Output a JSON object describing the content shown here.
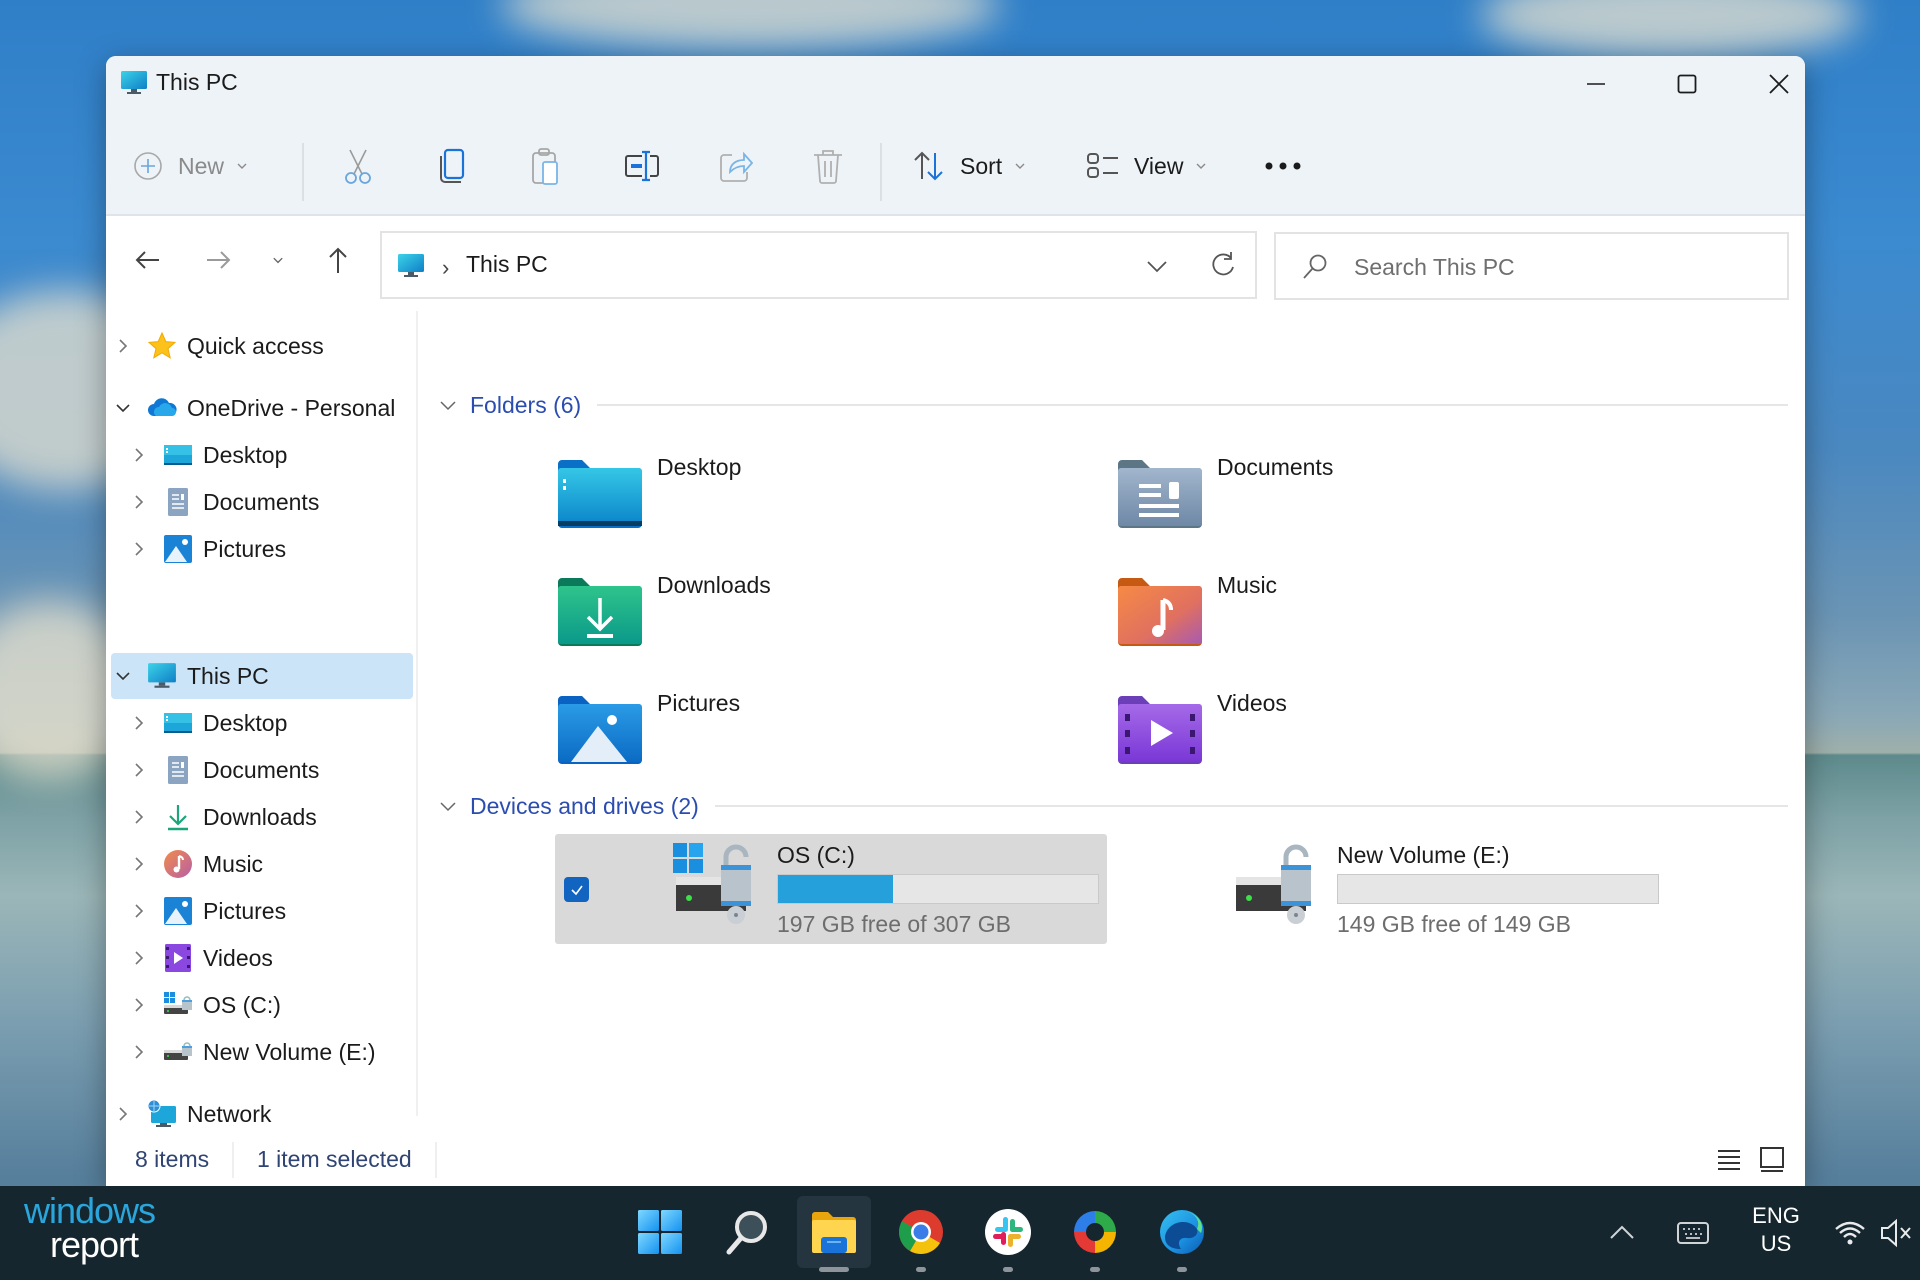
{
  "window": {
    "title": "This PC",
    "controls": {
      "minimize": "minimize",
      "maximize": "maximize",
      "close": "close"
    }
  },
  "toolbar": {
    "new_label": "New",
    "sort_label": "Sort",
    "view_label": "View",
    "icons": [
      "plus-circle-icon",
      "cut-icon",
      "copy-icon",
      "paste-icon",
      "rename-icon",
      "share-icon",
      "delete-icon",
      "sort-icon",
      "view-icon",
      "more-icon"
    ]
  },
  "nav": {
    "breadcrumb": [
      "This PC"
    ],
    "search_placeholder": "Search This PC",
    "search_value": ""
  },
  "sidebar": {
    "items": [
      {
        "label": "Quick access",
        "icon": "star-icon",
        "level": 0,
        "expanded": false
      },
      {
        "label": "OneDrive - Personal",
        "icon": "onedrive-cloud-icon",
        "level": 0,
        "expanded": true
      },
      {
        "label": "Desktop",
        "icon": "desktop-folder-icon",
        "level": 1
      },
      {
        "label": "Documents",
        "icon": "documents-icon",
        "level": 1
      },
      {
        "label": "Pictures",
        "icon": "pictures-icon",
        "level": 1
      },
      {
        "label": "This PC",
        "icon": "this-pc-icon",
        "level": 0,
        "expanded": true,
        "selected": true
      },
      {
        "label": "Desktop",
        "icon": "desktop-folder-icon",
        "level": 1
      },
      {
        "label": "Documents",
        "icon": "documents-icon",
        "level": 1
      },
      {
        "label": "Downloads",
        "icon": "downloads-icon",
        "level": 1
      },
      {
        "label": "Music",
        "icon": "music-icon",
        "level": 1
      },
      {
        "label": "Pictures",
        "icon": "pictures-icon",
        "level": 1
      },
      {
        "label": "Videos",
        "icon": "videos-icon",
        "level": 1
      },
      {
        "label": "OS (C:)",
        "icon": "os-drive-icon",
        "level": 1
      },
      {
        "label": "New Volume (E:)",
        "icon": "drive-icon",
        "level": 1
      },
      {
        "label": "Network",
        "icon": "network-icon",
        "level": 0,
        "expanded": false
      }
    ]
  },
  "main": {
    "folders_header": "Folders (6)",
    "folders": [
      {
        "name": "Desktop",
        "icon": "desktop-folder-icon"
      },
      {
        "name": "Documents",
        "icon": "documents-folder-icon"
      },
      {
        "name": "Downloads",
        "icon": "downloads-folder-icon"
      },
      {
        "name": "Music",
        "icon": "music-folder-icon"
      },
      {
        "name": "Pictures",
        "icon": "pictures-folder-icon"
      },
      {
        "name": "Videos",
        "icon": "videos-folder-icon"
      }
    ],
    "drives_header": "Devices and drives (2)",
    "drives": [
      {
        "name": "OS (C:)",
        "free_text": "197 GB free of 307 GB",
        "free_gb": 197,
        "total_gb": 307,
        "used_fraction": 0.358,
        "selected": true,
        "checked": true
      },
      {
        "name": "New Volume (E:)",
        "free_text": "149 GB free of 149 GB",
        "free_gb": 149,
        "total_gb": 149,
        "used_fraction": 0.0,
        "selected": false
      }
    ]
  },
  "statusbar": {
    "item_count": "8 items",
    "selection": "1 item selected"
  },
  "taskbar": {
    "logo_line1": "windows",
    "logo_line2": "report",
    "apps": [
      "start",
      "search",
      "file-explorer",
      "chrome",
      "slack",
      "snipping-tool",
      "edge"
    ],
    "active_app": "file-explorer",
    "lang_line1": "ENG",
    "lang_line2": "US"
  },
  "colors": {
    "accent": "#0067c0",
    "selection": "#cce4f7",
    "group_header": "#2b4db0",
    "drive_bar": "#26a0da",
    "taskbar": "#15262f"
  }
}
